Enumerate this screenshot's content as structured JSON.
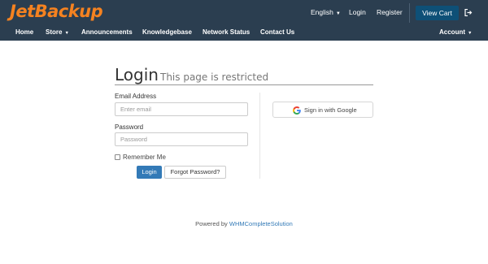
{
  "brand": {
    "logo_text": "JetBackup",
    "logo_color": "#f58220"
  },
  "topbar": {
    "language_label": "English",
    "login_label": "Login",
    "register_label": "Register",
    "cart_label": "View Cart",
    "logout_icon": "sign-out-icon"
  },
  "nav": {
    "items": [
      {
        "label": "Home"
      },
      {
        "label": "Store"
      },
      {
        "label": "Announcements"
      },
      {
        "label": "Knowledgebase"
      },
      {
        "label": "Network Status"
      },
      {
        "label": "Contact Us"
      }
    ],
    "account_label": "Account"
  },
  "login": {
    "title": "Login",
    "subtitle": "This page is restricted",
    "email_label": "Email Address",
    "email_placeholder": "Enter email",
    "email_value": "",
    "password_label": "Password",
    "password_placeholder": "Password",
    "password_value": "",
    "remember_label": "Remember Me",
    "remember_checked": false,
    "login_button": "Login",
    "forgot_button": "Forgot Password?",
    "google_button": "Sign in with Google"
  },
  "footer": {
    "powered_by": "Powered by",
    "link_text": "WHMCompleteSolution"
  },
  "colors": {
    "header_bg": "#2b3e50",
    "cart_button": "#0e5077",
    "primary_button": "#337ab7",
    "link": "#337ab7"
  }
}
